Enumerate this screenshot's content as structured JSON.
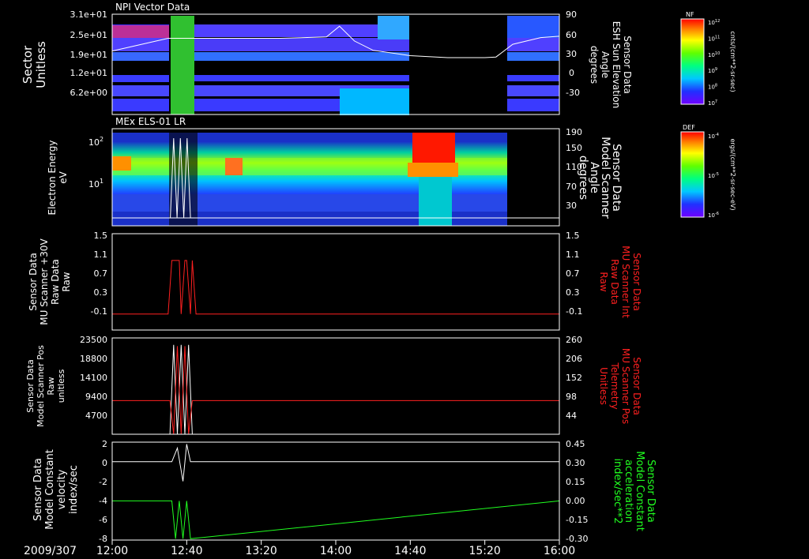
{
  "date_label": "2009/307",
  "time_axis": {
    "ticks": [
      "12:00",
      "12:40",
      "13:20",
      "14:00",
      "14:40",
      "15:20",
      "16:00"
    ]
  },
  "panels": [
    {
      "title": "NPI Vector Data",
      "ylabel": [
        "Sector",
        "Unitless"
      ],
      "left_ticks": [
        "3.1e+01",
        "2.5e+01",
        "1.9e+01",
        "1.2e+01",
        "6.2e+00"
      ],
      "right_ticks": [
        "90",
        "60",
        "30",
        "0",
        "-30"
      ],
      "right_label": [
        "Sensor Data",
        "ESH Sun Elevation",
        "Angle",
        "degrees"
      ],
      "right_label_color": "#ffffff"
    },
    {
      "title": "MEx ELS-01 LR",
      "ylabel": [
        "Electron Energy",
        "eV"
      ],
      "left_ticks": [
        "10",
        "10",
        "10"
      ],
      "left_tick_exps": [
        "2",
        "1",
        ""
      ],
      "right_ticks": [
        "190",
        "150",
        "110",
        "70",
        "30"
      ],
      "right_label": [
        "Sensor Data",
        "Model Scanner",
        "Angle",
        "degrees"
      ],
      "right_label_color": "#ffffff"
    },
    {
      "title": "",
      "ylabel": [
        "Sensor Data",
        "MU Scanner +30V",
        "Raw Data",
        "Raw"
      ],
      "left_ticks": [
        "1.5",
        "1.1",
        "0.7",
        "0.3",
        "-0.1"
      ],
      "right_ticks": [
        "1.5",
        "1.1",
        "0.7",
        "0.3",
        "-0.1"
      ],
      "right_label": [
        "Sensor Data",
        "MU Scanner Int",
        "Raw Data",
        "Raw"
      ],
      "right_label_color": "#ff2020"
    },
    {
      "title": "",
      "ylabel": [
        "Sensor Data",
        "Model Scanner Pos",
        "Raw",
        "unitless"
      ],
      "left_ticks": [
        "23500",
        "18800",
        "14100",
        "9400",
        "4700"
      ],
      "right_ticks": [
        "260",
        "206",
        "152",
        "98",
        "44"
      ],
      "right_label": [
        "Sensor Data",
        "MU Scanner Pos",
        "Telemetry",
        "Unitless"
      ],
      "right_label_color": "#ff2020"
    },
    {
      "title": "",
      "ylabel": [
        "Sensor Data",
        "Model Constant",
        "velocity",
        "index/sec"
      ],
      "left_ticks": [
        "2",
        "0",
        "-2",
        "-4",
        "-6",
        "-8"
      ],
      "right_ticks": [
        "0.45",
        "0.30",
        "0.15",
        "0.00",
        "-0.15",
        "-0.30"
      ],
      "right_label": [
        "Sensor Data",
        "Model Constant",
        "acceleration",
        "index/sec**2"
      ],
      "right_label_color": "#20ff20"
    }
  ],
  "colorbars": [
    {
      "tag": "NF",
      "unit": "cnts/(cm**2-sr-sec)",
      "ticks": [
        "10",
        "10",
        "10",
        "10",
        "10",
        "10"
      ],
      "exps": [
        "12",
        "11",
        "10",
        "9",
        "8",
        "7"
      ]
    },
    {
      "tag": "DEF",
      "unit": "ergs/(cm**2-sr-sec-eV)",
      "ticks": [
        "10",
        "10",
        "10"
      ],
      "exps": [
        "-4",
        "-5",
        "-6"
      ]
    }
  ],
  "chart_data": [
    {
      "type": "heatmap",
      "title": "NPI Vector Data",
      "ylabel": "Sector Unitless",
      "y2label": "Sensor Data ESH Sun Elevation Angle degrees",
      "xlim": [
        "12:00",
        "16:00"
      ],
      "ylim": [
        0,
        31
      ],
      "y2lim": [
        -60,
        90
      ],
      "series": [
        {
          "name": "Sensor Data ESH Sun Elevation Angle degrees",
          "x": [
            "12:00",
            "12:30",
            "12:42",
            "13:00",
            "13:30",
            "13:55",
            "14:02",
            "14:10",
            "14:20",
            "14:40",
            "15:00",
            "15:20",
            "15:26",
            "15:35",
            "15:50",
            "16:00"
          ],
          "y": [
            35,
            54,
            54,
            54,
            54,
            56,
            72,
            50,
            36,
            28,
            25,
            25,
            26,
            45,
            55,
            57
          ]
        }
      ]
    },
    {
      "type": "heatmap",
      "title": "MEx ELS-01 LR",
      "ylabel": "Electron Energy eV",
      "y2label": "Sensor Data Model Scanner Angle degrees",
      "xlim": [
        "12:00",
        "16:00"
      ],
      "y_log": true,
      "y2lim": [
        0,
        190
      ],
      "y2_ticks": [
        190,
        150,
        110,
        70,
        30
      ]
    },
    {
      "type": "line",
      "ylabel": "Sensor Data MU Scanner +30V Raw Data Raw",
      "y2label": "Sensor Data MU Scanner Int Raw Data Raw",
      "xlim": [
        "12:00",
        "16:00"
      ],
      "ylim": [
        -0.3,
        1.5
      ],
      "series": [
        {
          "name": "Sensor Data MU Scanner Int Raw Data Raw",
          "x": [
            "12:00",
            "12:30",
            "12:32",
            "12:34",
            "12:36",
            "12:37",
            "12:39",
            "12:40",
            "12:42",
            "12:43",
            "12:45",
            "16:00"
          ],
          "y": [
            0.0,
            0.0,
            1.0,
            1.0,
            1.0,
            0.0,
            1.0,
            1.0,
            0.0,
            1.0,
            0.0,
            0.0
          ]
        }
      ]
    },
    {
      "type": "line",
      "ylabel": "Sensor Data Model Scanner Pos Raw unitless",
      "y2label": "Sensor Data MU Scanner Pos Telemetry Unitless",
      "xlim": [
        "12:00",
        "16:00"
      ],
      "ylim": [
        0,
        23500
      ],
      "y2lim": [
        0,
        260
      ],
      "series": [
        {
          "name": "Sensor Data MU Scanner Pos Telemetry Unitless",
          "x": [
            "12:00",
            "12:31",
            "12:33",
            "12:35",
            "12:37",
            "12:39",
            "12:41",
            "12:43",
            "12:45",
            "16:00"
          ],
          "y": [
            8200,
            8200,
            0,
            21500,
            0,
            21500,
            0,
            8200,
            8200,
            8200
          ]
        }
      ]
    },
    {
      "type": "line",
      "ylabel": "Sensor Data Model Constant velocity index/sec",
      "y2label": "Sensor Data Model Constant acceleration index/sec**2",
      "xlim": [
        "12:00",
        "16:00"
      ],
      "ylim": [
        -8,
        2
      ],
      "y2lim": [
        -0.3,
        0.45
      ],
      "series": [
        {
          "name": "Sensor Data Model Constant velocity index/sec",
          "x": [
            "12:00",
            "12:32",
            "12:35",
            "12:38",
            "12:40",
            "12:42",
            "16:00"
          ],
          "y": [
            0,
            0,
            1.4,
            -2,
            1.8,
            0,
            0
          ]
        },
        {
          "name": "Sensor Data Model Constant acceleration index/sec**2",
          "x": [
            "12:00",
            "12:32",
            "12:34",
            "12:36",
            "12:38",
            "12:40",
            "12:42",
            "16:00"
          ],
          "y": [
            0.0,
            0.0,
            -0.29,
            0.0,
            -0.29,
            0.0,
            -0.29,
            0.0
          ]
        }
      ]
    }
  ]
}
